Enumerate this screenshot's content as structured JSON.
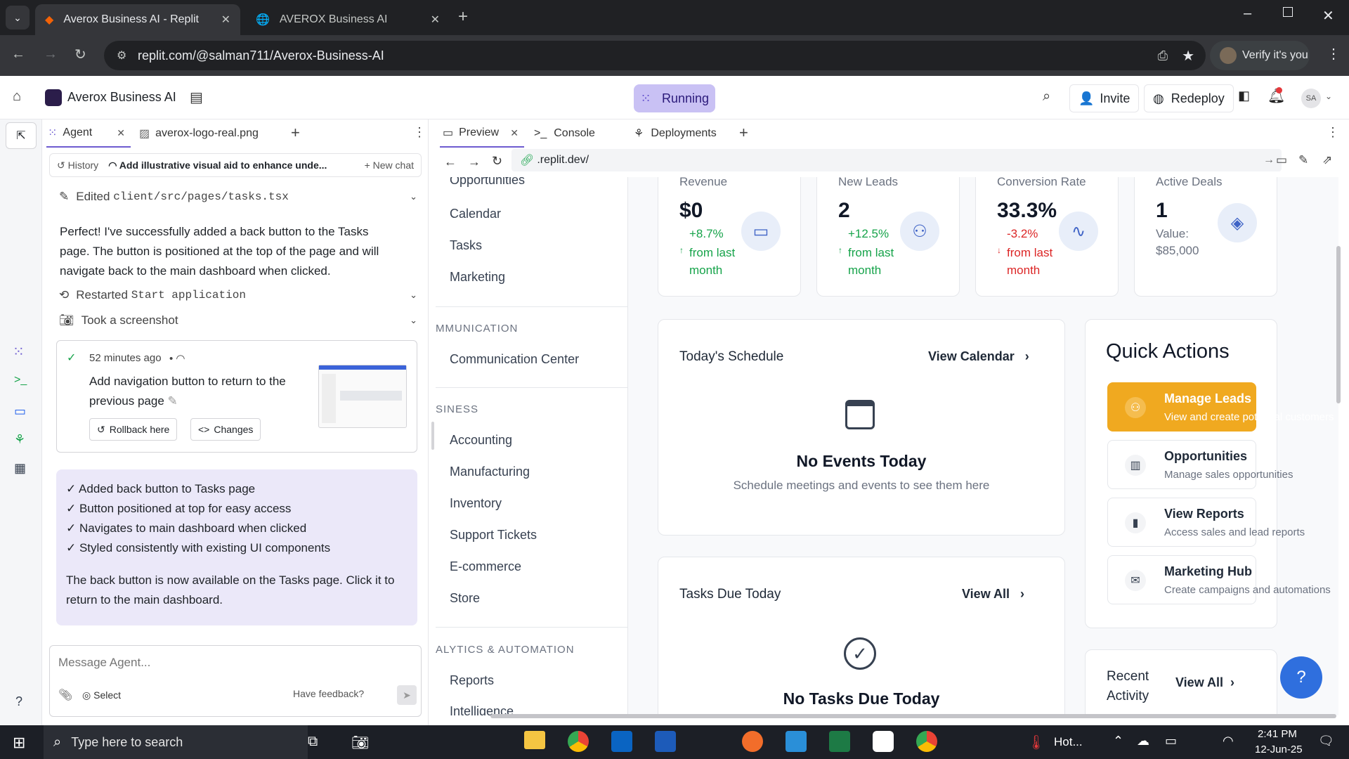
{
  "browser": {
    "tabs": [
      {
        "title": "Averox Business AI - Replit",
        "active": true
      },
      {
        "title": "AVEROX Business AI",
        "active": false
      }
    ],
    "url": "replit.com/@salman711/Averox-Business-AI",
    "verify_label": "Verify it's you"
  },
  "replit": {
    "project_name": "Averox Business AI",
    "run_status": "Running",
    "invite_label": "Invite",
    "redeploy_label": "Redeploy",
    "avatar_initials": "SA",
    "accent": "#6d5bd0"
  },
  "agent_panel": {
    "tabs": [
      "Agent",
      "averox-logo-real.png"
    ],
    "history_label": "History",
    "chat_title": "Add illustrative visual aid to enhance unde...",
    "new_chat_label": "New chat",
    "edited_prefix": "Edited",
    "edited_file": "client/src/pages/tasks.tsx",
    "message_1": "Perfect! I've successfully added a back button to the Tasks page. The button is positioned at the top of the page and will navigate back to the main dashboard when clicked.",
    "restarted_prefix": "Restarted",
    "restarted_target": "Start application",
    "screenshot_label": "Took a screenshot",
    "checkpoint": {
      "time": "52 minutes ago",
      "title": "Add navigation button to return to the previous page",
      "rollback_label": "Rollback here",
      "changes_label": "Changes"
    },
    "summary_items": [
      "✓ Added back button to Tasks page",
      "✓ Button positioned at top for easy access",
      "✓ Navigates to main dashboard when clicked",
      "✓ Styled consistently with existing UI components"
    ],
    "summary_footer": "The back button is now available on the Tasks page. Click it to return to the main dashboard.",
    "input_placeholder": "Message Agent...",
    "select_label": "Select",
    "feedback_label": "Have feedback?"
  },
  "preview_panel": {
    "tabs": [
      "Preview",
      "Console",
      "Deployments"
    ],
    "url": ".replit.dev/"
  },
  "app": {
    "nav": {
      "top_items": [
        "Opportunities",
        "Calendar",
        "Tasks",
        "Marketing"
      ],
      "sections": [
        {
          "header": "MMUNICATION",
          "items": [
            "Communication Center"
          ]
        },
        {
          "header": "SINESS",
          "items": [
            "Accounting",
            "Manufacturing",
            "Inventory",
            "Support Tickets",
            "E-commerce",
            "Store"
          ]
        },
        {
          "header": "ALYTICS & AUTOMATION",
          "items": [
            "Reports",
            "Intelligence"
          ]
        }
      ]
    },
    "stats": [
      {
        "label": "Revenue",
        "value": "$0",
        "change": "+8.7%",
        "note": "from last month",
        "trend": "up"
      },
      {
        "label": "New Leads",
        "value": "2",
        "change": "+12.5%",
        "note": "from last month",
        "trend": "up"
      },
      {
        "label": "Conversion Rate",
        "value": "33.3%",
        "change": "-3.2%",
        "note": "from last month",
        "trend": "down"
      },
      {
        "label": "Active Deals",
        "value": "1",
        "change": "Value:",
        "note": "$85,000",
        "trend": "neutral"
      }
    ],
    "schedule": {
      "title": "Today's Schedule",
      "link": "View Calendar",
      "empty_title": "No Events Today",
      "empty_text": "Schedule meetings and events to see them here"
    },
    "tasks": {
      "title": "Tasks Due Today",
      "link": "View All",
      "empty_title": "No Tasks Due Today"
    },
    "quick_actions": {
      "title": "Quick Actions",
      "items": [
        {
          "title": "Manage Leads",
          "subtitle": "View and create potential customers",
          "icon": "users-icon",
          "highlight": true
        },
        {
          "title": "Opportunities",
          "subtitle": "Manage sales opportunities",
          "icon": "bar-chart-icon",
          "highlight": false
        },
        {
          "title": "View Reports",
          "subtitle": "Access sales and lead reports",
          "icon": "signal-icon",
          "highlight": false
        },
        {
          "title": "Marketing Hub",
          "subtitle": "Create campaigns and automations",
          "icon": "mail-icon",
          "highlight": false
        }
      ],
      "highlight_color": "#f0a920"
    },
    "recent_activity": {
      "title": "Recent Activity",
      "link": "View All"
    }
  },
  "taskbar": {
    "search_placeholder": "Type here to search",
    "weather": "Hot...",
    "time": "2:41 PM",
    "date": "12-Jun-25"
  }
}
